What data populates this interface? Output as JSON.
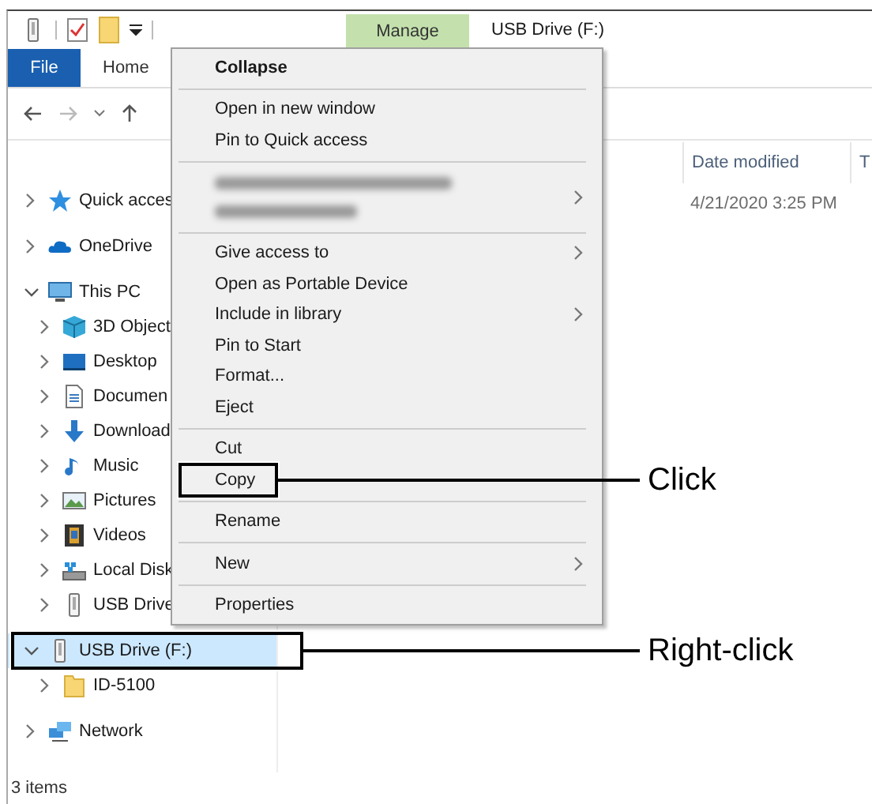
{
  "title_bar": {
    "contextual_tab": "Manage",
    "title": "USB Drive (F:)"
  },
  "ribbon_tabs": [
    {
      "label": "File",
      "kind": "file"
    },
    {
      "label": "Home",
      "kind": "tab"
    }
  ],
  "nav_pane": {
    "items": [
      {
        "label": "Quick acces",
        "kind": "star",
        "expanded": false,
        "selected": false
      },
      {
        "label": "OneDrive",
        "kind": "cloud",
        "expanded": false,
        "selected": false
      },
      {
        "label": "This PC",
        "kind": "pc",
        "expanded": true,
        "selected": false,
        "children": [
          {
            "label": "3D Object",
            "kind": "cube",
            "expanded": false,
            "selected": false
          },
          {
            "label": "Desktop",
            "kind": "desktop",
            "expanded": false,
            "selected": false
          },
          {
            "label": "Documen",
            "kind": "document",
            "expanded": false,
            "selected": false
          },
          {
            "label": "Download",
            "kind": "download",
            "expanded": false,
            "selected": false
          },
          {
            "label": "Music",
            "kind": "music",
            "expanded": false,
            "selected": false
          },
          {
            "label": "Pictures",
            "kind": "picture",
            "expanded": false,
            "selected": false
          },
          {
            "label": "Videos",
            "kind": "film",
            "expanded": false,
            "selected": false
          },
          {
            "label": "Local Disk",
            "kind": "disk",
            "expanded": false,
            "selected": false
          },
          {
            "label": "USB Drive",
            "kind": "usb",
            "expanded": false,
            "selected": false
          }
        ]
      },
      {
        "label": "USB Drive (F:)",
        "kind": "usb",
        "expanded": true,
        "selected": true,
        "callout": "Right-click",
        "children": [
          {
            "label": "ID-5100",
            "kind": "folder",
            "expanded": false,
            "selected": false
          }
        ]
      },
      {
        "label": "Network",
        "kind": "network",
        "expanded": false,
        "selected": false
      }
    ]
  },
  "file_list": {
    "columns": [
      "Date modified",
      "T"
    ],
    "rows": [
      {
        "date_modified": "4/21/2020 3:25 PM"
      }
    ]
  },
  "context_menu": {
    "items": [
      {
        "kind": "default",
        "label": "Collapse"
      },
      {
        "kind": "separator"
      },
      {
        "kind": "item",
        "label": "Open in new window"
      },
      {
        "kind": "item",
        "label": "Pin to Quick access"
      },
      {
        "kind": "separator"
      },
      {
        "kind": "blurred",
        "submenu": true
      },
      {
        "kind": "separator"
      },
      {
        "kind": "item",
        "label": "Give access to",
        "submenu": true
      },
      {
        "kind": "item",
        "label": "Open as Portable Device"
      },
      {
        "kind": "item",
        "label": "Include in library",
        "submenu": true
      },
      {
        "kind": "item",
        "label": "Pin to Start"
      },
      {
        "kind": "item",
        "label": "Format..."
      },
      {
        "kind": "item",
        "label": "Eject"
      },
      {
        "kind": "separator"
      },
      {
        "kind": "item",
        "label": "Cut"
      },
      {
        "kind": "item",
        "label": "Copy",
        "callout": "Click"
      },
      {
        "kind": "separator"
      },
      {
        "kind": "item",
        "label": "Rename"
      },
      {
        "kind": "separator"
      },
      {
        "kind": "item",
        "label": "New",
        "submenu": true
      },
      {
        "kind": "separator"
      },
      {
        "kind": "item",
        "label": "Properties"
      }
    ]
  },
  "status_bar": {
    "text": "3 items"
  }
}
